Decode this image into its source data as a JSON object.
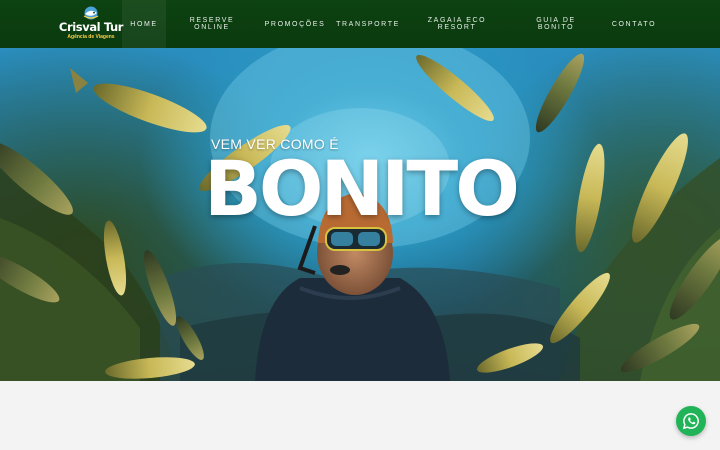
{
  "brand": {
    "name": "Crisval Tur",
    "tagline": "Agência de Viagens",
    "colors": {
      "nav_bg": "#0b3a0f",
      "logo_accent": "#ffd34a",
      "whatsapp": "#20b358"
    }
  },
  "nav": {
    "items": [
      {
        "label": "HOME",
        "active": true
      },
      {
        "label": "RESERVE ONLINE",
        "lines": [
          "RESERVE",
          "ONLINE"
        ]
      },
      {
        "label": "PROMOÇÕES"
      },
      {
        "label": "TRANSPORTE"
      },
      {
        "label": "ZAGAIA ECO RESORT",
        "lines": [
          "ZAGAIA ECO",
          "RESORT"
        ]
      },
      {
        "label": "GUIA DE BONITO",
        "lines": [
          "GUIA DE",
          "BONITO"
        ]
      },
      {
        "label": "CONTATO"
      }
    ]
  },
  "hero": {
    "kicker": "VEM VER COMO É",
    "title": "BONITO"
  },
  "icons": {
    "logo": "fish-logo-icon",
    "chat": "whatsapp-icon"
  }
}
